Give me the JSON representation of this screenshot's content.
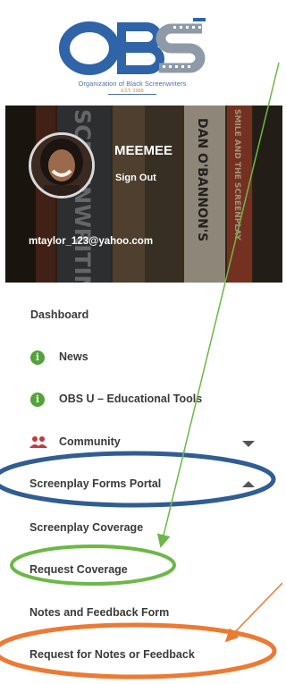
{
  "logo": {
    "letters": "OBS",
    "org_name": "Organization of Black Screenwriters",
    "established": "EST. 1988"
  },
  "profile": {
    "username": "MEEMEE",
    "sign_out": "Sign Out",
    "email": "mtaylor_123@yahoo.com"
  },
  "banner_book_text": [
    "SCREENWRITING",
    "DAN O'BANNON'S",
    "SMILE AND THE SCREENPLAY"
  ],
  "nav": {
    "dashboard": "Dashboard",
    "news": "News",
    "obs_u": "OBS U – Educational Tools",
    "community": "Community",
    "screenplay_forms_portal": "Screenplay Forms Portal",
    "screenplay_coverage": "Screenplay Coverage",
    "request_coverage": "Request Coverage",
    "notes_feedback_form": "Notes and Feedback Form",
    "request_notes_feedback": "Request for Notes or Feedback"
  },
  "colors": {
    "logo_blue": "#2f64a8",
    "logo_gray": "#8e9aa8",
    "icon_green": "#52a33a",
    "community_red": "#c8353b",
    "annotation_blue": "#2f5d94",
    "annotation_green": "#6cb846",
    "annotation_orange": "#ec7a33"
  }
}
